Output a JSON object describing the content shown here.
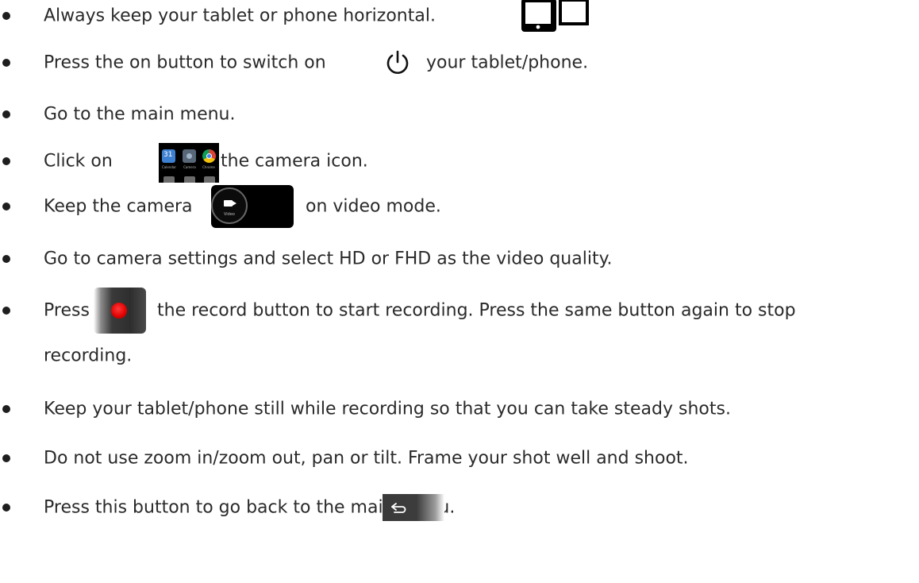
{
  "instructions": [
    {
      "id": "horizontal",
      "text_before": "Always keep your tablet or phone horizontal.",
      "icon": "orientation-icon"
    },
    {
      "id": "power",
      "text_before": "Press the on button to switch on",
      "icon": "power-icon",
      "text_after": "your tablet/phone."
    },
    {
      "id": "menu",
      "text_before": "Go to the main menu."
    },
    {
      "id": "camera-app",
      "text_before": "Click on",
      "icon": "app-icons",
      "text_after": "the camera icon."
    },
    {
      "id": "video-mode",
      "text_before": "Keep the camera",
      "icon": "video-mode-icon",
      "text_after": "on video mode."
    },
    {
      "id": "quality",
      "text_before": "Go to camera settings and select HD or FHD as the video quality."
    },
    {
      "id": "record",
      "text_before": "Press",
      "icon": "record-button-icon",
      "text_after": "the record button to start recording. Press the same button again to stop",
      "continuation": "recording."
    },
    {
      "id": "steady",
      "text_before": "Keep your tablet/phone still while recording so that you can take steady shots."
    },
    {
      "id": "zoom",
      "text_before": "Do not use zoom in/zoom out, pan or tilt. Frame your shot well and shoot."
    },
    {
      "id": "back",
      "text_before": "Press this button to go back to the main menu.",
      "icon": "back-button-icon"
    }
  ],
  "icons": {
    "app_labels": [
      "Calendar",
      "Camera",
      "Chrome"
    ],
    "calendar_day": "31",
    "video_label": "Video"
  },
  "colors": {
    "text": "#2a2a2a",
    "record_red": "#e00000",
    "icon_black": "#000000"
  }
}
